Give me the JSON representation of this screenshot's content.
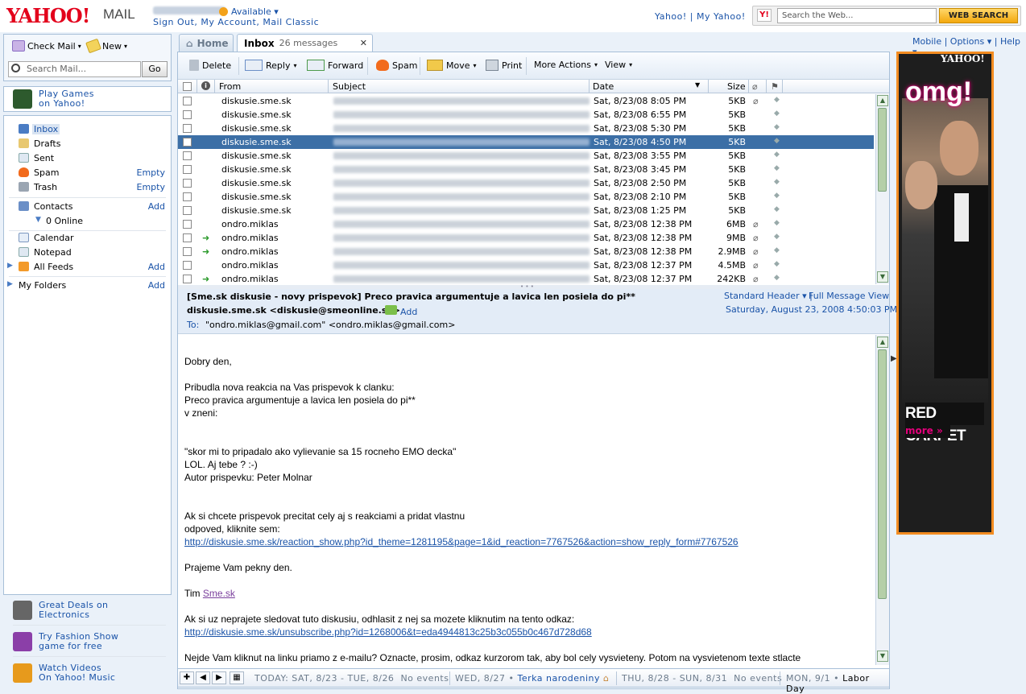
{
  "header": {
    "logo": "YAHOO!",
    "product": "MAIL",
    "status": "Available",
    "links": "Sign Out, My Account, Mail Classic",
    "yahoo_links": "Yahoo! | My Yahoo!",
    "search_placeholder": "Search the Web...",
    "search_button": "WEB SEARCH"
  },
  "left": {
    "check_mail": "Check Mail",
    "new": "New",
    "search_mail_placeholder": "Search Mail...",
    "go": "Go",
    "games": [
      "Play Games",
      "on Yahoo!"
    ],
    "folders": [
      {
        "label": "Inbox",
        "action": ""
      },
      {
        "label": "Drafts",
        "action": ""
      },
      {
        "label": "Sent",
        "action": ""
      },
      {
        "label": "Spam",
        "action": "Empty"
      },
      {
        "label": "Trash",
        "action": "Empty"
      },
      {
        "label": "Contacts",
        "action": "Add"
      },
      {
        "label": "0 Online",
        "action": ""
      },
      {
        "label": "Calendar",
        "action": ""
      },
      {
        "label": "Notepad",
        "action": ""
      },
      {
        "label": "All Feeds",
        "action": "Add"
      },
      {
        "label": "My Folders",
        "action": "Add"
      }
    ],
    "promos": [
      {
        "line1": "Great Deals on",
        "line2": "Electronics"
      },
      {
        "line1": "Try Fashion Show",
        "line2": "game for free"
      },
      {
        "line1": "Watch Videos",
        "line2": "On Yahoo! Music"
      }
    ]
  },
  "tabs": {
    "home": "Home",
    "inbox": "Inbox",
    "inbox_count": "26 messages",
    "close": "✕"
  },
  "toolbar": {
    "delete": "Delete",
    "reply": "Reply",
    "forward": "Forward",
    "spam": "Spam",
    "move": "Move",
    "print": "Print",
    "more_actions": "More Actions",
    "view": "View"
  },
  "columns": {
    "from": "From",
    "subject": "Subject",
    "date": "Date",
    "size": "Size"
  },
  "messages": [
    {
      "from": "diskusie.sme.sk",
      "date": "Sat, 8/23/08 8:05 PM",
      "size": "5KB",
      "attach": true,
      "replied": false
    },
    {
      "from": "diskusie.sme.sk",
      "date": "Sat, 8/23/08 6:55 PM",
      "size": "5KB",
      "attach": false,
      "replied": false
    },
    {
      "from": "diskusie.sme.sk",
      "date": "Sat, 8/23/08 5:30 PM",
      "size": "5KB",
      "attach": false,
      "replied": false
    },
    {
      "from": "diskusie.sme.sk",
      "date": "Sat, 8/23/08 4:50 PM",
      "size": "5KB",
      "attach": false,
      "replied": false,
      "selected": true
    },
    {
      "from": "diskusie.sme.sk",
      "date": "Sat, 8/23/08 3:55 PM",
      "size": "5KB",
      "attach": false,
      "replied": false
    },
    {
      "from": "diskusie.sme.sk",
      "date": "Sat, 8/23/08 3:45 PM",
      "size": "5KB",
      "attach": false,
      "replied": false
    },
    {
      "from": "diskusie.sme.sk",
      "date": "Sat, 8/23/08 2:50 PM",
      "size": "5KB",
      "attach": false,
      "replied": false
    },
    {
      "from": "diskusie.sme.sk",
      "date": "Sat, 8/23/08 2:10 PM",
      "size": "5KB",
      "attach": false,
      "replied": false
    },
    {
      "from": "diskusie.sme.sk",
      "date": "Sat, 8/23/08 1:25 PM",
      "size": "5KB",
      "attach": false,
      "replied": false
    },
    {
      "from": "ondro.miklas",
      "date": "Sat, 8/23/08 12:38 PM",
      "size": "6MB",
      "attach": true,
      "replied": false
    },
    {
      "from": "ondro.miklas",
      "date": "Sat, 8/23/08 12:38 PM",
      "size": "9MB",
      "attach": true,
      "replied": true
    },
    {
      "from": "ondro.miklas",
      "date": "Sat, 8/23/08 12:38 PM",
      "size": "2.9MB",
      "attach": true,
      "replied": true
    },
    {
      "from": "ondro.miklas",
      "date": "Sat, 8/23/08 12:37 PM",
      "size": "4.5MB",
      "attach": true,
      "replied": false
    },
    {
      "from": "ondro.miklas",
      "date": "Sat, 8/23/08 12:37 PM",
      "size": "242KB",
      "attach": true,
      "replied": true
    }
  ],
  "preview": {
    "subject": "[Sme.sk diskusie - novy prispevok] Preco pravica argumentuje a lavica len posiela do pi**",
    "from": "diskusie.sme.sk <diskusie@smeonline.sk>",
    "add": "Add",
    "to_label": "To:",
    "to": "\"ondro.miklas@gmail.com\" <ondro.miklas@gmail.com>",
    "standard_header": "Standard Header",
    "full_view": "Full Message View",
    "date": "Saturday, August 23, 2008 4:50:03 PM"
  },
  "body": {
    "l1": "Dobry den,",
    "l2": "Pribudla nova reakcia na Vas prispevok k clanku:",
    "l3": "Preco pravica argumentuje a lavica len posiela do pi**",
    "l4": "v zneni:",
    "l5": "\"skor mi to pripadalo ako vylievanie sa 15 rocneho EMO decka\"",
    "l6": "LOL. Aj tebe ? :-)",
    "l7": "Autor prispevku: Peter Molnar",
    "l8": "Ak si chcete prispevok precitat cely aj s reakciami a pridat vlastnu",
    "l9": "odpoved, kliknite sem:",
    "link1": "http://diskusie.sme.sk/reaction_show.php?id_theme=1281195&page=1&id_reaction=7767526&action=show_reply_form#7767526",
    "l10": "Prajeme Vam pekny den.",
    "l11a": "Tim ",
    "l11b": "Sme.sk",
    "l12": "Ak si uz neprajete sledovat tuto diskusiu, odhlasit z nej sa mozete kliknutim na tento odkaz:",
    "link2": "http://diskusie.sme.sk/unsubscribe.php?id=1268006&t=eda4944813c25b3c055b0c467d728d68",
    "l13": "Nejde Vam kliknut na linku priamo z e-mailu? Oznacte, prosim, odkaz kurzorom tak, aby bol cely vysvieteny. Potom na vysvietenom texte stlacte"
  },
  "calendar": {
    "today": "TODAY: SAT, 8/23 - TUE, 8/26",
    "no_events1": "No events",
    "wed": "WED, 8/27 •",
    "wed_event": "Terka narodeniny",
    "thu": "THU, 8/28 - SUN, 8/31",
    "no_events2": "No events",
    "mon": "MON, 9/1 •",
    "mon_event": "Labor Day"
  },
  "right": {
    "links": "Mobile | Options ▾ | Help ▾",
    "ad_logo": "YAHOO!",
    "ad_omg": "omg!",
    "ad_red": "RED CARPET",
    "ad_more": "more »"
  },
  "colors": {
    "accent": "#1a53a8",
    "selected_row": "#3c6fa6",
    "ad_border": "#f38c21"
  }
}
